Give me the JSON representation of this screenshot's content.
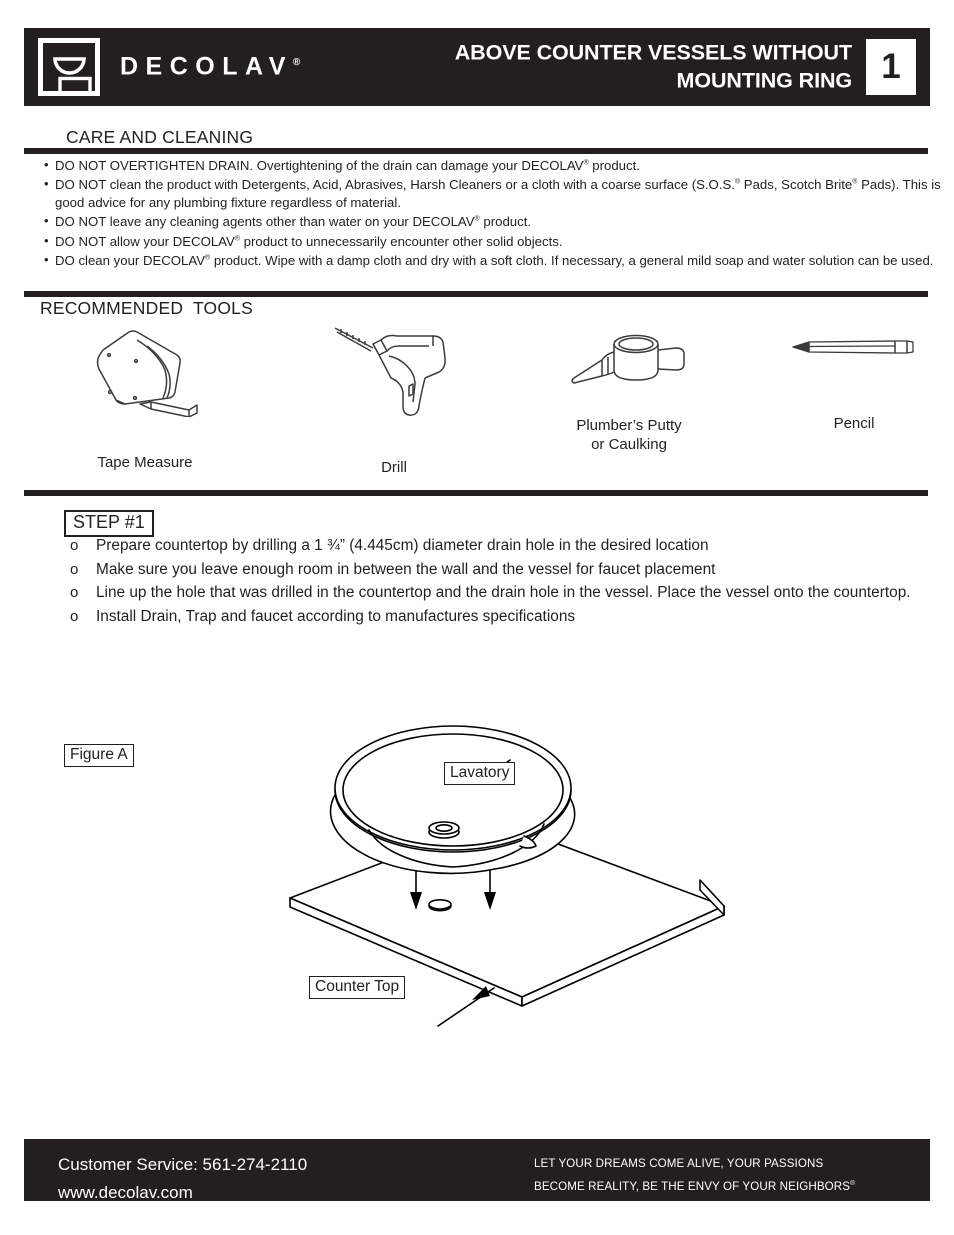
{
  "header": {
    "brand": "DECOLAV",
    "brand_reg": "®",
    "title": "ABOVE COUNTER VESSELS WITHOUT\nMOUNTING RING",
    "badge_number": "1",
    "logo_icon": "vessel-sink-logo-icon",
    "bg_color": "#231f20",
    "fg_color": "#ffffff"
  },
  "care": {
    "heading": "CARE AND CLEANING",
    "bullet_glyph": "•",
    "items": [
      {
        "parts": [
          {
            "text": "DO NOT OVERTIGHTEN DRAIN. Overtightening of the drain can damage your DECOLAV"
          },
          {
            "sup": "®"
          },
          {
            "text": " product."
          }
        ]
      },
      {
        "parts": [
          {
            "text": "DO NOT clean the product with Detergents, Acid, Abrasives, Harsh Cleaners or a cloth with a coarse surface (S.O.S."
          },
          {
            "sup": "®"
          },
          {
            "text": " Pads, Scotch Brite"
          },
          {
            "sup": "®"
          },
          {
            "text": " Pads). This is good advice for any plumbing fixture regardless of material."
          }
        ]
      },
      {
        "parts": [
          {
            "text": "DO NOT leave any cleaning agents other than water on your DECOLAV"
          },
          {
            "sup": "®"
          },
          {
            "text": " product."
          }
        ]
      },
      {
        "parts": [
          {
            "text": "DO NOT allow your DECOLAV"
          },
          {
            "sup": "®"
          },
          {
            "text": " product to unnecessarily encounter other solid objects."
          }
        ]
      },
      {
        "parts": [
          {
            "text": "DO clean your DECOLAV"
          },
          {
            "sup": "®"
          },
          {
            "text": " product. Wipe with a damp cloth and dry with a soft cloth. If necessary, a general mild soap and water solution can be used."
          }
        ]
      }
    ]
  },
  "tools": {
    "heading": "RECOMMENDED  TOOLS",
    "items": [
      {
        "label": "Tape Measure",
        "icon": "tape-measure-icon"
      },
      {
        "label": "Drill",
        "icon": "drill-icon"
      },
      {
        "label": "Plumber’s Putty\nor Caulking",
        "icon": "caulking-tube-icon"
      },
      {
        "label": "Pencil",
        "icon": "pencil-icon"
      }
    ]
  },
  "step": {
    "badge": "STEP #1",
    "marker_glyph": "o",
    "items": [
      "Prepare countertop by drilling a 1 ¾” (4.445cm) diameter drain hole in the desired location",
      "Make sure you leave enough room in between the wall and the vessel for faucet placement",
      "Line up the hole that was drilled in the countertop and the drain hole in the vessel. Place the vessel onto the countertop.",
      "Install Drain, Trap and faucet according to manufactures specifications"
    ]
  },
  "figure": {
    "tag": "Figure A",
    "callout_lavatory": "Lavatory",
    "callout_countertop": "Counter Top",
    "diagram_icon": "vessel-on-countertop-diagram"
  },
  "footer": {
    "customer_service": "Customer Service: 561-274-2110",
    "website": "www.decolav.com",
    "tagline_line1": "LET  YOUR DREAMS COME ALIVE, YOUR PASSIONS",
    "tagline_line2": "BECOME REALITY, BE THE ENVY OF YOUR  NEIGHBORS",
    "tagline_reg": "®"
  }
}
